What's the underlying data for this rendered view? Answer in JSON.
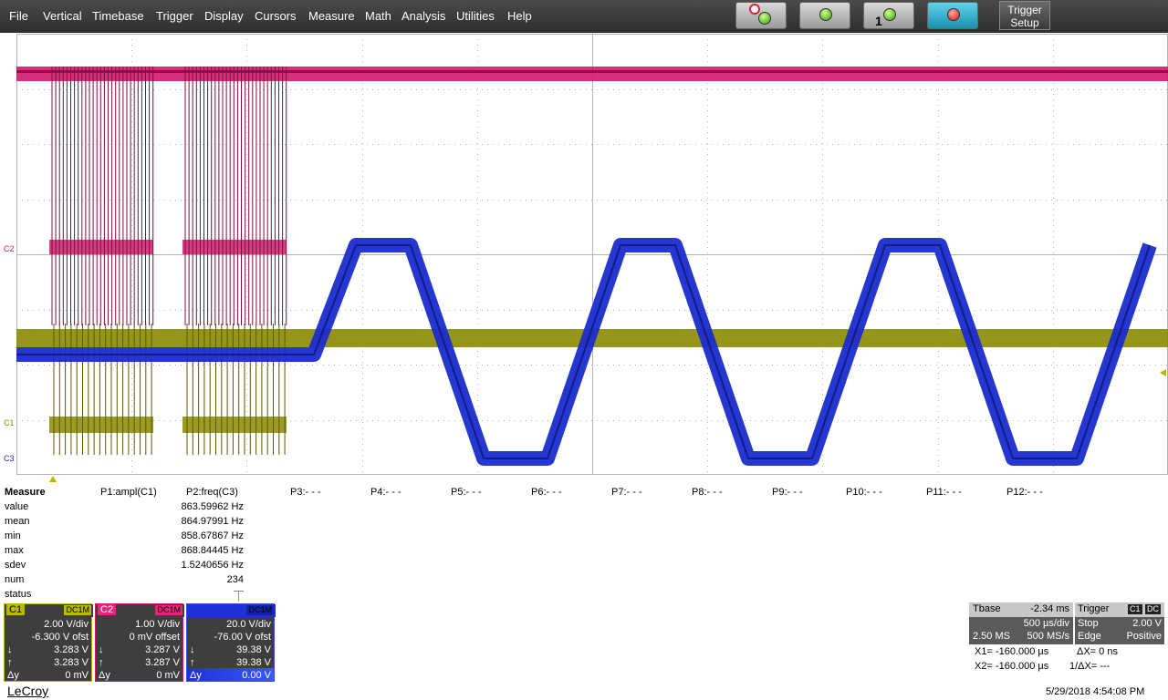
{
  "menu": [
    "File",
    "Vertical",
    "Timebase",
    "Trigger",
    "Display",
    "Cursors",
    "Measure",
    "Math",
    "Analysis",
    "Utilities",
    "Help"
  ],
  "toolbar": {
    "trigger_setup_line1": "Trigger",
    "trigger_setup_line2": "Setup",
    "single_label": "1"
  },
  "colors": {
    "c1": "#8a8a00",
    "c2": "#d0196a",
    "c3": "#1a2ccc",
    "grid": "#b4b4b4"
  },
  "channel_markers": {
    "c1": "C1",
    "c2": "C2",
    "c3": "C3"
  },
  "measure": {
    "title": "Measure",
    "params": [
      "P1:ampl(C1)",
      "P2:freq(C3)",
      "P3:- - -",
      "P4:- - -",
      "P5:- - -",
      "P6:- - -",
      "P7:- - -",
      "P8:- - -",
      "P9:- - -",
      "P10:- - -",
      "P11:- - -",
      "P12:- - -"
    ],
    "rows": [
      {
        "label": "value",
        "p2": "863.59962 Hz"
      },
      {
        "label": "mean",
        "p2": "864.97991 Hz"
      },
      {
        "label": "min",
        "p2": "858.67867 Hz"
      },
      {
        "label": "max",
        "p2": "868.84445 Hz"
      },
      {
        "label": "sdev",
        "p2": "1.5240656 Hz"
      },
      {
        "label": "num",
        "p2": "234"
      },
      {
        "label": "status",
        "p2": "⏉"
      }
    ]
  },
  "channels": [
    {
      "name": "C1",
      "coupling": "DC1M",
      "vdiv": "2.00 V/div",
      "offset": "-6.300 V ofst",
      "down": "3.283 V",
      "up": "3.283 V",
      "delta_label": "Δy",
      "delta": "0 mV"
    },
    {
      "name": "C2",
      "coupling": "DC1M",
      "vdiv": "1.00 V/div",
      "offset": "0 mV offset",
      "down": "3.287 V",
      "up": "3.287 V",
      "delta_label": "Δy",
      "delta": "0 mV"
    },
    {
      "name": "C3",
      "coupling": "DC1M",
      "vdiv": "20.0 V/div",
      "offset": "-76.00 V ofst",
      "down": "39.38 V",
      "up": "39.38 V",
      "delta_label": "Δy",
      "delta": "0.00 V"
    }
  ],
  "timebase": {
    "label": "Tbase",
    "delay": "-2.34 ms",
    "tdiv": "500 µs/div",
    "samples": "2.50 MS",
    "rate": "500 MS/s"
  },
  "trigger": {
    "label": "Trigger",
    "source": "C1",
    "coupling": "DC",
    "mode": "Stop",
    "level": "2.00 V",
    "type": "Edge",
    "slope": "Positive"
  },
  "cursors": {
    "x1": "X1=  -160.000 µs",
    "x2": "X2=  -160.000 µs",
    "dx": "ΔX=  0 ns",
    "inv_dx": "1/ΔX=     ---"
  },
  "brand": "LeCroy",
  "datetime": "5/29/2018 4:54:08 PM"
}
